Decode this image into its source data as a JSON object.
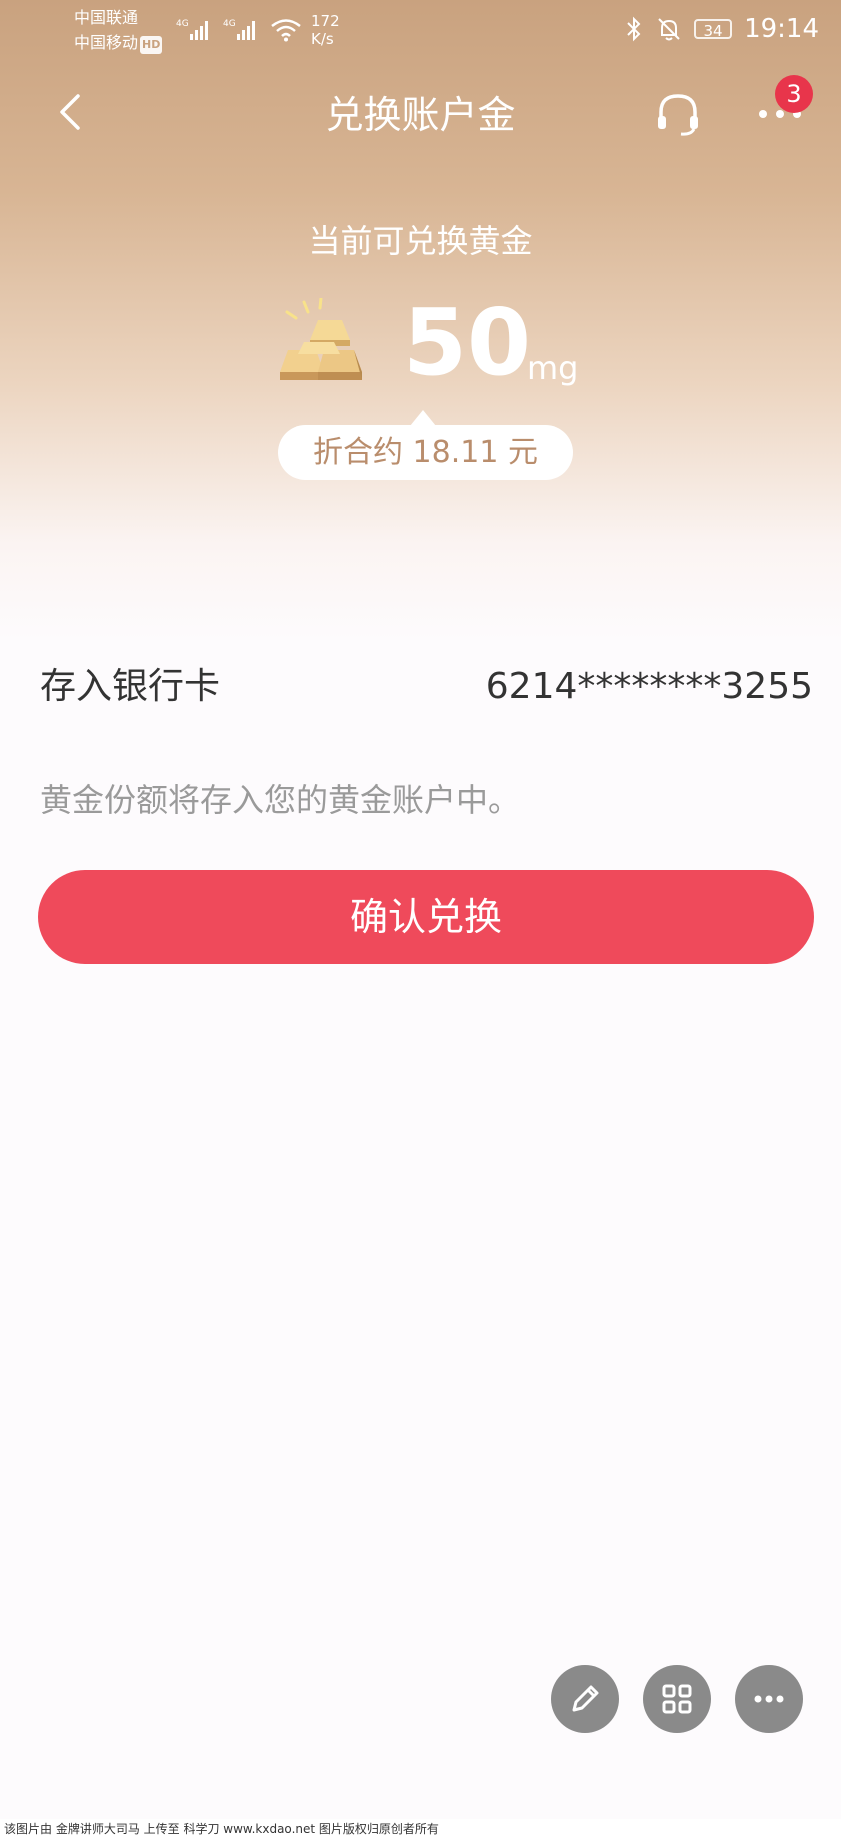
{
  "status_bar": {
    "carrier1": "中国联通",
    "carrier2": "中国移动",
    "hd": "HD",
    "net1": "4G",
    "net2": "4G",
    "speed_value": "172",
    "speed_unit": "K/s",
    "battery": "34",
    "time": "19:14"
  },
  "nav": {
    "title": "兑换账户金",
    "badge_count": "3"
  },
  "gold": {
    "label": "当前可兑换黄金",
    "amount": "50",
    "unit": "mg",
    "equivalent": "折合约 18.11 元"
  },
  "deposit": {
    "label": "存入银行卡",
    "card_number": "6214********3255",
    "note": "黄金份额将存入您的黄金账户中。"
  },
  "confirm_button": "确认兑换",
  "fabs": [
    "pencil-icon",
    "grid-icon",
    "more-icon"
  ],
  "footer": "该图片由 金牌讲师大司马 上传至 科学刀 www.kxdao.net 图片版权归原创者所有",
  "colors": {
    "accent": "#ef4a5b",
    "hero_top": "#c9a27f",
    "badge": "#e8354b",
    "pill_text": "#b98d6c"
  }
}
